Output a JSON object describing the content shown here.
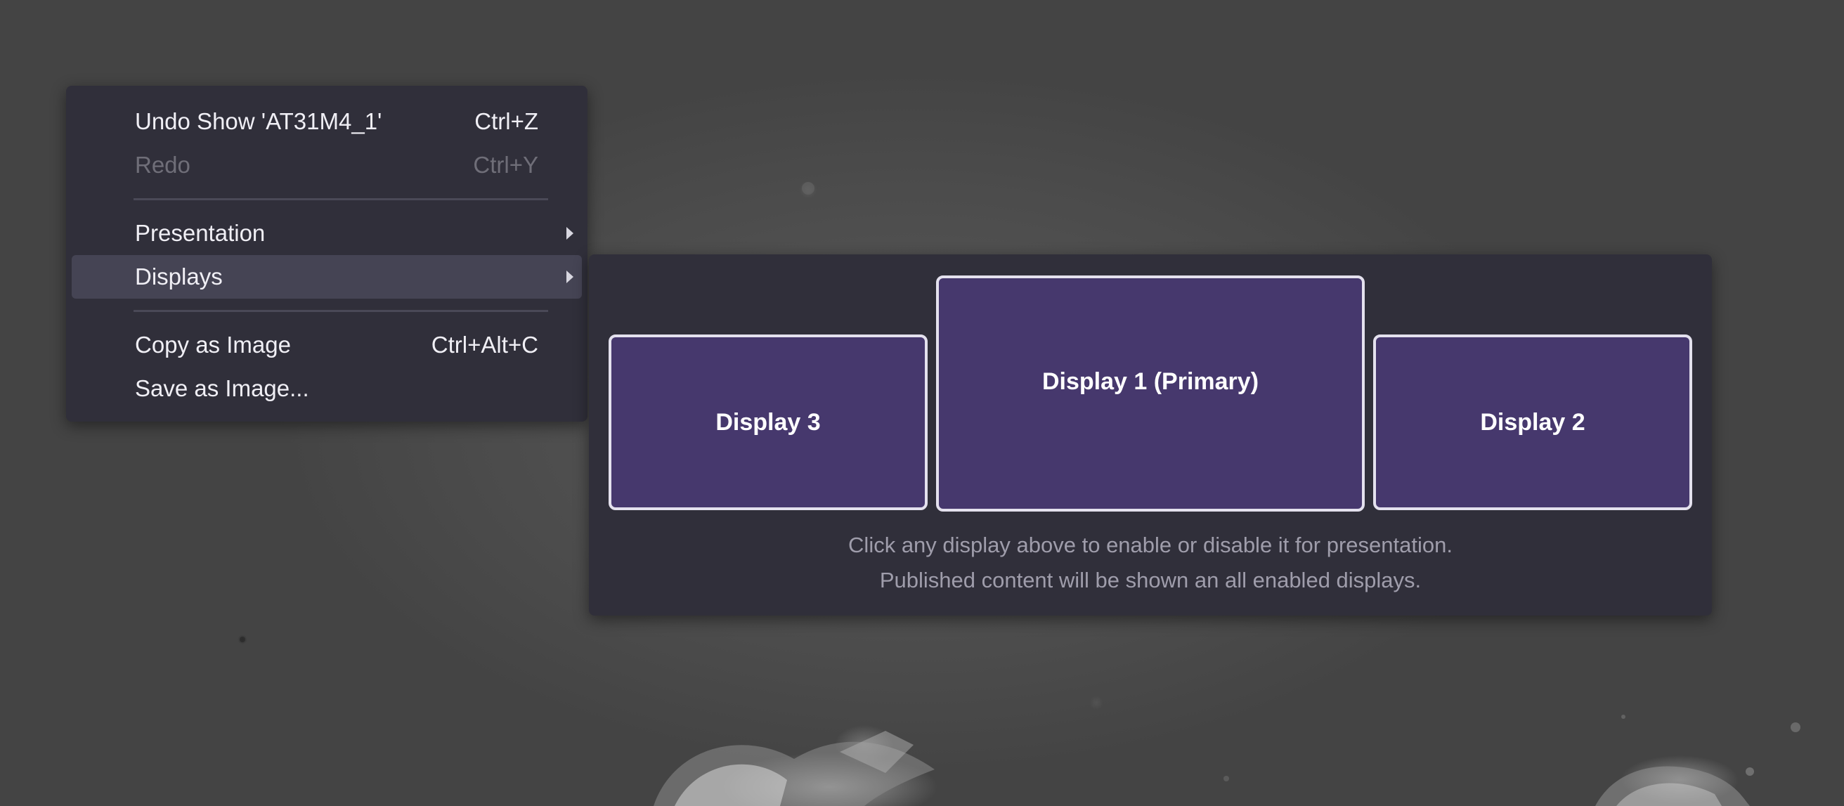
{
  "context_menu": {
    "items": [
      {
        "label": "Undo Show 'AT31M4_1'",
        "shortcut": "Ctrl+Z"
      },
      {
        "label": "Redo",
        "shortcut": "Ctrl+Y",
        "disabled": true
      },
      {
        "label": "Presentation",
        "submenu": true
      },
      {
        "label": "Displays",
        "submenu": true,
        "highlighted": true
      },
      {
        "label": "Copy as Image",
        "shortcut": "Ctrl+Alt+C"
      },
      {
        "label": "Save as Image..."
      }
    ]
  },
  "displays_submenu": {
    "displays": [
      {
        "label": "Display 3"
      },
      {
        "label": "Display 1 (Primary)",
        "primary": true
      },
      {
        "label": "Display 2"
      }
    ],
    "hint_line_1": "Click any display above to enable or disable it for presentation.",
    "hint_line_2": "Published content will be shown an all enabled displays."
  },
  "colors": {
    "menu_background": "#302f3a",
    "menu_highlight": "#454454",
    "display_tile_fill": "#46386d",
    "display_tile_border": "#e4e1ee",
    "disabled_text": "#6f6e78"
  },
  "icons": {
    "submenu_arrow": "chevron-right-icon"
  }
}
